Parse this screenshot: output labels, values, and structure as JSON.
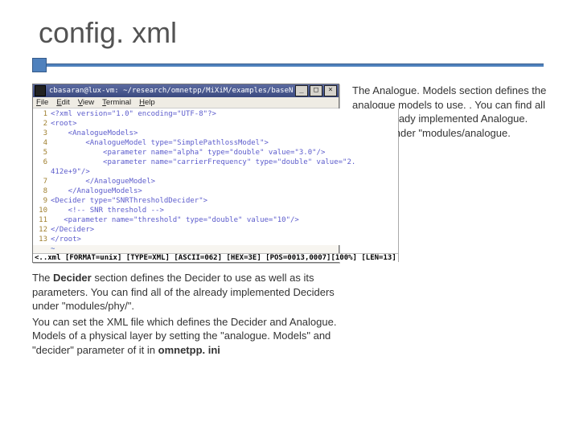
{
  "title": "config. xml",
  "terminal": {
    "window_title": "cbasaran@lux-vm: ~/research/omnetpp/MiXiM/examples/baseNetwork",
    "menu": [
      "File",
      "Edit",
      "View",
      "Terminal",
      "Help"
    ],
    "code_lines": [
      {
        "n": "1",
        "text": "<?xml version=\"1.0\" encoding=\"UTF-8\"?>"
      },
      {
        "n": "2",
        "text": "<root>"
      },
      {
        "n": "3",
        "text": "    <AnalogueModels>"
      },
      {
        "n": "4",
        "text": "        <AnalogueModel type=\"SimplePathlossModel\">"
      },
      {
        "n": "5",
        "text": "            <parameter name=\"alpha\" type=\"double\" value=\"3.0\"/>"
      },
      {
        "n": "6",
        "text": "            <parameter name=\"carrierFrequency\" type=\"double\" value=\"2."
      },
      {
        "n": "",
        "text": "412e+9\"/>"
      },
      {
        "n": "7",
        "text": "        </AnalogueModel>"
      },
      {
        "n": "8",
        "text": "    </AnalogueModels>"
      },
      {
        "n": "9",
        "text": "<Decider type=\"SNRThresholdDecider\">"
      },
      {
        "n": "10",
        "text": "    <!-- SNR threshold -->"
      },
      {
        "n": "11",
        "text": "   <parameter name=\"threshold\" type=\"double\" value=\"10\"/>"
      },
      {
        "n": "12",
        "text": "</Decider>"
      },
      {
        "n": "13",
        "text": "</root>"
      }
    ],
    "status": "<..xml [FORMAT=unix] [TYPE=XML] [ASCII=062] [HEX=3E] [POS=0013,0007][100%] [LEN=13]"
  },
  "right_text": "The  Analogue. Models section defines the analogue models to use. . You can find all of the already implemented Analogue. Models under \"modules/analogue. Model/\".",
  "bottom_prefix": "The ",
  "bottom_bold": "Decider",
  "bottom_text1": " section defines the Decider to use as well as its parameters. You can find all of the already implemented Deciders under \"modules/phy/\".",
  "bottom_text2": "You can set the XML file which defines the Decider and Analogue. Models of a physical layer by setting the \"analogue. Models\" and \"decider\" parameter of it in ",
  "bottom_bold2": "omnetpp. ini"
}
